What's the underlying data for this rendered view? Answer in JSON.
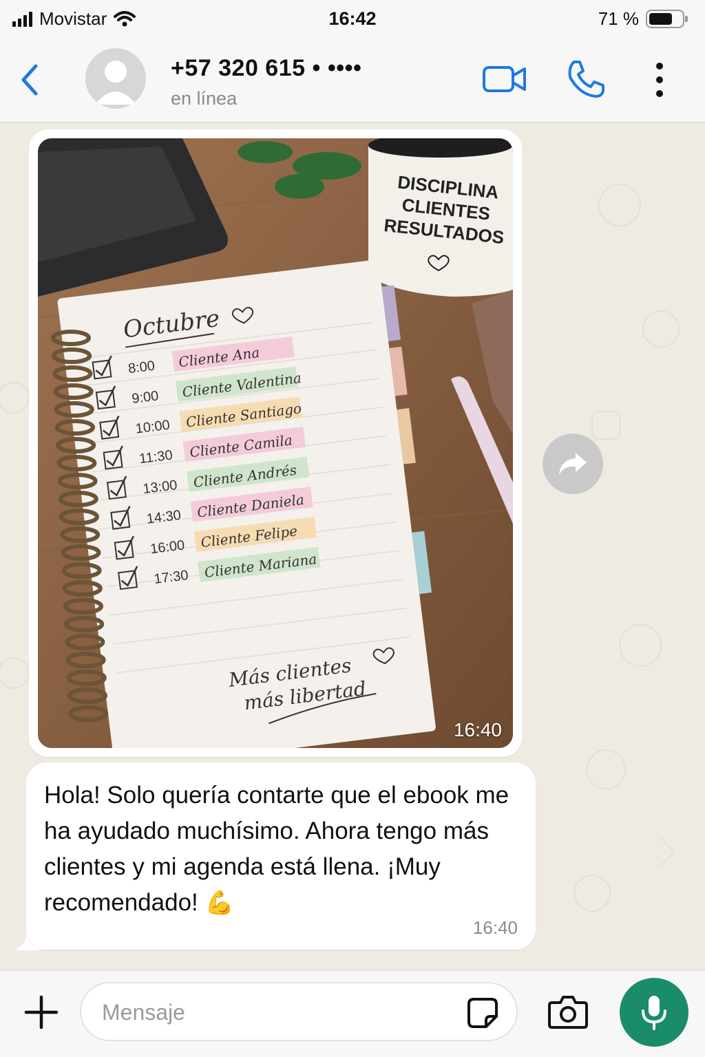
{
  "status_bar": {
    "carrier": "Movistar",
    "time": "16:42",
    "battery": "71 %",
    "battery_level": 0.71
  },
  "header": {
    "contact_name": "+57 320 615 • ••••",
    "contact_status": "en línea",
    "icons": [
      "back-chevron-icon",
      "video-call-icon",
      "phone-icon",
      "more-vertical-icon"
    ]
  },
  "photo": {
    "mug_text": [
      "DISCIPLINA",
      "CLIENTES",
      "RESULTADOS"
    ],
    "notebook_title": "Octubre",
    "schedule": [
      {
        "time": "8:00",
        "client": "Cliente Ana"
      },
      {
        "time": "9:00",
        "client": "Cliente Valentina"
      },
      {
        "time": "10:00",
        "client": "Cliente Santiago"
      },
      {
        "time": "11:30",
        "client": "Cliente Camila"
      },
      {
        "time": "13:00",
        "client": "Cliente Andrés"
      },
      {
        "time": "14:30",
        "client": "Cliente Daniela"
      },
      {
        "time": "16:00",
        "client": "Cliente Felipe"
      },
      {
        "time": "17:30",
        "client": "Cliente Mariana"
      }
    ],
    "footer_line1": "Más clientes",
    "footer_line2": "más libertad",
    "timestamp": "16:40"
  },
  "message": {
    "text": "Hola! Solo quería contarte que el ebook me ha ayudado muchísimo. Ahora tengo más clientes y mi agenda está llena. ¡Muy recomendado!",
    "emoji": "💪",
    "timestamp": "16:40"
  },
  "input_bar": {
    "placeholder": "Mensaje",
    "icons": [
      "plus-icon",
      "sticker-icon",
      "camera-icon",
      "microphone-icon"
    ]
  },
  "colors": {
    "accent_blue": "#1f7ae0",
    "mic_green": "#1a8c6a",
    "chat_background": "#efeae2"
  }
}
